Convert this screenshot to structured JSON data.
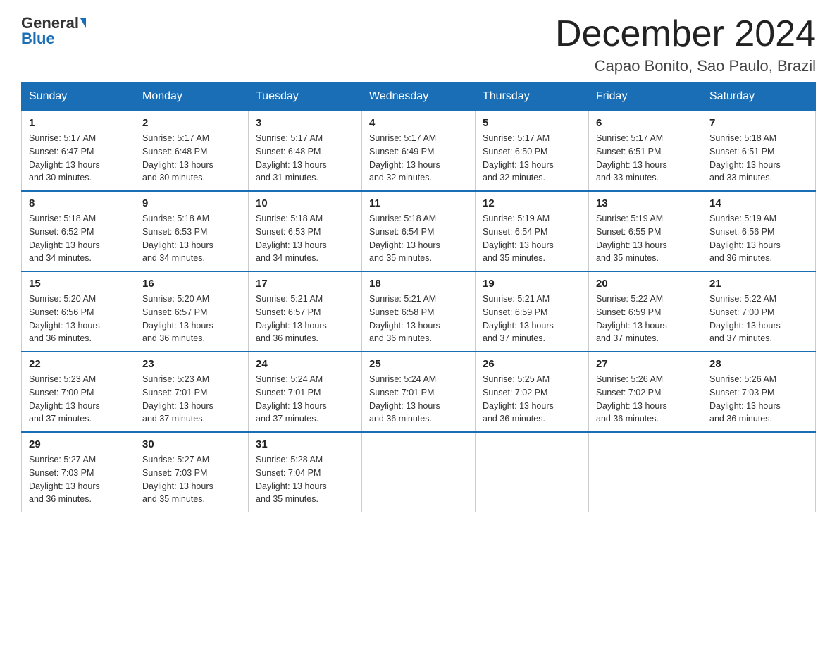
{
  "header": {
    "logo_line1": "General",
    "logo_line2": "Blue",
    "month_title": "December 2024",
    "location": "Capao Bonito, Sao Paulo, Brazil"
  },
  "days_of_week": [
    "Sunday",
    "Monday",
    "Tuesday",
    "Wednesday",
    "Thursday",
    "Friday",
    "Saturday"
  ],
  "weeks": [
    [
      {
        "day": "1",
        "sunrise": "5:17 AM",
        "sunset": "6:47 PM",
        "daylight": "13 hours and 30 minutes."
      },
      {
        "day": "2",
        "sunrise": "5:17 AM",
        "sunset": "6:48 PM",
        "daylight": "13 hours and 30 minutes."
      },
      {
        "day": "3",
        "sunrise": "5:17 AM",
        "sunset": "6:48 PM",
        "daylight": "13 hours and 31 minutes."
      },
      {
        "day": "4",
        "sunrise": "5:17 AM",
        "sunset": "6:49 PM",
        "daylight": "13 hours and 32 minutes."
      },
      {
        "day": "5",
        "sunrise": "5:17 AM",
        "sunset": "6:50 PM",
        "daylight": "13 hours and 32 minutes."
      },
      {
        "day": "6",
        "sunrise": "5:17 AM",
        "sunset": "6:51 PM",
        "daylight": "13 hours and 33 minutes."
      },
      {
        "day": "7",
        "sunrise": "5:18 AM",
        "sunset": "6:51 PM",
        "daylight": "13 hours and 33 minutes."
      }
    ],
    [
      {
        "day": "8",
        "sunrise": "5:18 AM",
        "sunset": "6:52 PM",
        "daylight": "13 hours and 34 minutes."
      },
      {
        "day": "9",
        "sunrise": "5:18 AM",
        "sunset": "6:53 PM",
        "daylight": "13 hours and 34 minutes."
      },
      {
        "day": "10",
        "sunrise": "5:18 AM",
        "sunset": "6:53 PM",
        "daylight": "13 hours and 34 minutes."
      },
      {
        "day": "11",
        "sunrise": "5:18 AM",
        "sunset": "6:54 PM",
        "daylight": "13 hours and 35 minutes."
      },
      {
        "day": "12",
        "sunrise": "5:19 AM",
        "sunset": "6:54 PM",
        "daylight": "13 hours and 35 minutes."
      },
      {
        "day": "13",
        "sunrise": "5:19 AM",
        "sunset": "6:55 PM",
        "daylight": "13 hours and 35 minutes."
      },
      {
        "day": "14",
        "sunrise": "5:19 AM",
        "sunset": "6:56 PM",
        "daylight": "13 hours and 36 minutes."
      }
    ],
    [
      {
        "day": "15",
        "sunrise": "5:20 AM",
        "sunset": "6:56 PM",
        "daylight": "13 hours and 36 minutes."
      },
      {
        "day": "16",
        "sunrise": "5:20 AM",
        "sunset": "6:57 PM",
        "daylight": "13 hours and 36 minutes."
      },
      {
        "day": "17",
        "sunrise": "5:21 AM",
        "sunset": "6:57 PM",
        "daylight": "13 hours and 36 minutes."
      },
      {
        "day": "18",
        "sunrise": "5:21 AM",
        "sunset": "6:58 PM",
        "daylight": "13 hours and 36 minutes."
      },
      {
        "day": "19",
        "sunrise": "5:21 AM",
        "sunset": "6:59 PM",
        "daylight": "13 hours and 37 minutes."
      },
      {
        "day": "20",
        "sunrise": "5:22 AM",
        "sunset": "6:59 PM",
        "daylight": "13 hours and 37 minutes."
      },
      {
        "day": "21",
        "sunrise": "5:22 AM",
        "sunset": "7:00 PM",
        "daylight": "13 hours and 37 minutes."
      }
    ],
    [
      {
        "day": "22",
        "sunrise": "5:23 AM",
        "sunset": "7:00 PM",
        "daylight": "13 hours and 37 minutes."
      },
      {
        "day": "23",
        "sunrise": "5:23 AM",
        "sunset": "7:01 PM",
        "daylight": "13 hours and 37 minutes."
      },
      {
        "day": "24",
        "sunrise": "5:24 AM",
        "sunset": "7:01 PM",
        "daylight": "13 hours and 37 minutes."
      },
      {
        "day": "25",
        "sunrise": "5:24 AM",
        "sunset": "7:01 PM",
        "daylight": "13 hours and 36 minutes."
      },
      {
        "day": "26",
        "sunrise": "5:25 AM",
        "sunset": "7:02 PM",
        "daylight": "13 hours and 36 minutes."
      },
      {
        "day": "27",
        "sunrise": "5:26 AM",
        "sunset": "7:02 PM",
        "daylight": "13 hours and 36 minutes."
      },
      {
        "day": "28",
        "sunrise": "5:26 AM",
        "sunset": "7:03 PM",
        "daylight": "13 hours and 36 minutes."
      }
    ],
    [
      {
        "day": "29",
        "sunrise": "5:27 AM",
        "sunset": "7:03 PM",
        "daylight": "13 hours and 36 minutes."
      },
      {
        "day": "30",
        "sunrise": "5:27 AM",
        "sunset": "7:03 PM",
        "daylight": "13 hours and 35 minutes."
      },
      {
        "day": "31",
        "sunrise": "5:28 AM",
        "sunset": "7:04 PM",
        "daylight": "13 hours and 35 minutes."
      },
      null,
      null,
      null,
      null
    ]
  ],
  "labels": {
    "sunrise": "Sunrise:",
    "sunset": "Sunset:",
    "daylight": "Daylight:"
  }
}
